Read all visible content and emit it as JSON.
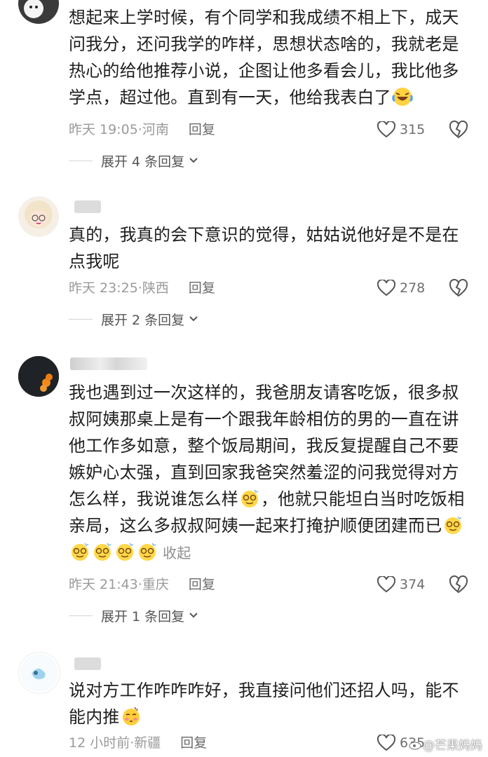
{
  "comments": [
    {
      "text": "想起来上学时候，有个同学和我成绩不相上下，成天问我分，还问我学的咋样，思想状态啥的，我就老是热心的给他推荐小说，企图让他多看会儿，我比他多学点，超过他。直到有一天，他给我表白了",
      "time": "昨天 19:05",
      "location": "河南",
      "reply_label": "回复",
      "likes": "315",
      "expand_label": "展开 4 条回复",
      "emoji_icon": "laughing-tears-emoji"
    },
    {
      "text": "真的，我真的会下意识的觉得，姑姑说他好是不是在点我呢",
      "time": "昨天 23:25",
      "location": "陕西",
      "reply_label": "回复",
      "likes": "278",
      "expand_label": "展开 2 条回复"
    },
    {
      "text_part1": "我也遇到过一次这样的，我爸朋友请客吃饭，很多叔叔阿姨那桌上是有一个跟我年龄相仿的男的一直在讲他工作多如意，整个饭局期间，我反复提醒自己不要嫉妒心太强，直到回家我爸突然羞涩的问我觉得对方怎么样，我说谁怎么样",
      "text_part2": "，他就只能坦白当时吃饭相亲局，这么多叔叔阿姨一起来打掩护顺便团建而已",
      "collapse_label": "收起",
      "time": "昨天 21:43",
      "location": "重庆",
      "reply_label": "回复",
      "likes": "374",
      "expand_label": "展开 1 条回复",
      "emoji_icon": "dizzy-smile-emoji"
    },
    {
      "text": "说对方工作咋咋咋好，我直接问他们还招人吗，能不能内推",
      "time": "12 小时前",
      "location": "新疆",
      "reply_label": "回复",
      "likes": "635",
      "emoji_icon": "shy-blush-emoji"
    }
  ],
  "watermark": "@芒果妈妈",
  "colors": {
    "text": "#1e1e1e",
    "meta": "#9a9a9a",
    "bg": "#ffffff"
  }
}
